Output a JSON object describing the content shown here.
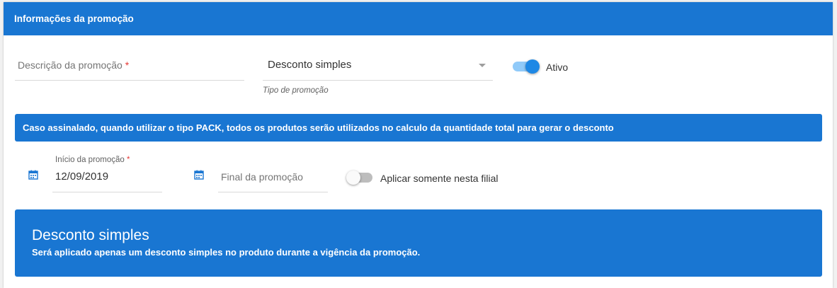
{
  "header": {
    "title": "Informações da promoção"
  },
  "form": {
    "description": {
      "label": "Descrição da promoção",
      "required_mark": "*",
      "value": ""
    },
    "promo_type": {
      "selected": "Desconto simples",
      "hint": "Tipo de promoção"
    },
    "active_toggle": {
      "label": "Ativo",
      "checked": true
    },
    "info_message": "Caso assinalado, quando utilizar o tipo PACK, todos os produtos serão utilizados no calculo da quantidade total para gerar o desconto",
    "start_date": {
      "label": "Início da promoção",
      "required_mark": "*",
      "value": "12/09/2019"
    },
    "end_date": {
      "label": "Final da promoção",
      "value": ""
    },
    "branch_toggle": {
      "label": "Aplicar somente nesta filial",
      "checked": false
    }
  },
  "discount_info": {
    "title": "Desconto simples",
    "description": "Será aplicado apenas um desconto simples no produto durante a vigência da promoção."
  },
  "colors": {
    "primary": "#1976d2",
    "toggle_on": "#1e88e5",
    "required": "#e53935"
  },
  "icons": {
    "start_date": "calendar-icon",
    "end_date": "calendar-icon",
    "type_dropdown": "caret-down-icon"
  }
}
